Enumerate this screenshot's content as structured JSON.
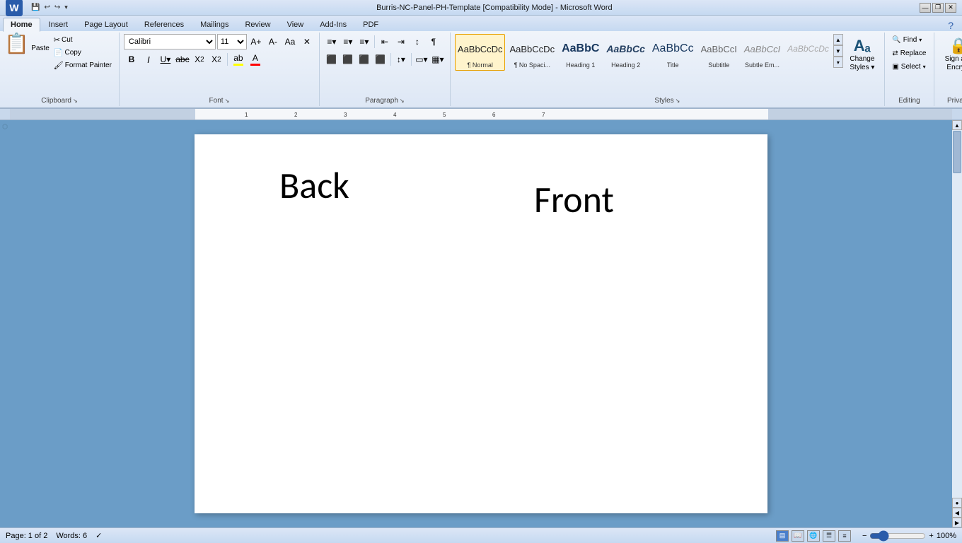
{
  "titlebar": {
    "title": "Burris-NC-Panel-PH-Template [Compatibility Mode] - Microsoft Word",
    "word_letter": "W",
    "quick_save": "💾",
    "quick_undo": "↩",
    "quick_redo": "↪",
    "min": "—",
    "restore": "❐",
    "close": "✕"
  },
  "tabs": [
    {
      "label": "Home",
      "active": true
    },
    {
      "label": "Insert",
      "active": false
    },
    {
      "label": "Page Layout",
      "active": false
    },
    {
      "label": "References",
      "active": false
    },
    {
      "label": "Mailings",
      "active": false
    },
    {
      "label": "Review",
      "active": false
    },
    {
      "label": "View",
      "active": false
    },
    {
      "label": "Add-Ins",
      "active": false
    },
    {
      "label": "PDF",
      "active": false
    }
  ],
  "clipboard": {
    "paste_label": "Paste",
    "cut_label": "Cut",
    "copy_label": "Copy",
    "format_painter_label": "Format Painter",
    "group_label": "Clipboard"
  },
  "font": {
    "name": "Calibri",
    "size": "11",
    "group_label": "Font",
    "bold": "B",
    "italic": "I",
    "underline": "U",
    "strikethrough": "abc",
    "subscript": "X₂",
    "superscript": "X²",
    "change_case": "Aa",
    "highlight": "A",
    "font_color": "A"
  },
  "paragraph": {
    "group_label": "Paragraph",
    "bullets": "≡",
    "numbering": "≡",
    "multilevel": "≡",
    "decrease_indent": "⇐",
    "increase_indent": "⇒",
    "sort": "↕",
    "show_marks": "¶",
    "align_left": "≡",
    "align_center": "≡",
    "align_right": "≡",
    "justify": "≡",
    "line_spacing": "≡",
    "shading": "▭",
    "border": "▭"
  },
  "styles": {
    "group_label": "Styles",
    "items": [
      {
        "label": "¶ Normal",
        "class": "normal-style",
        "active": true
      },
      {
        "label": "¶ No Spaci...",
        "class": "no-spacing-style",
        "active": false
      },
      {
        "label": "Heading 1",
        "class": "heading1-style",
        "active": false
      },
      {
        "label": "Heading 2",
        "class": "heading2-style",
        "active": false
      },
      {
        "label": "Title",
        "class": "title-style",
        "active": false
      },
      {
        "label": "Subtitle",
        "class": "subtitle-style",
        "active": false
      },
      {
        "label": "Subtle Em...",
        "class": "subtle-em-style",
        "active": false
      },
      {
        "label": "AaBbCcDc",
        "class": "subtle-em2-style",
        "active": false
      }
    ],
    "change_styles_label": "Change\nStyles",
    "expand_icon": "▼"
  },
  "editing": {
    "group_label": "Editing",
    "find_label": "Find",
    "replace_label": "Replace",
    "select_label": "Select"
  },
  "privacy": {
    "sign_encrypt_label": "Sign and\nEncrypt",
    "group_label": "Privacy"
  },
  "document": {
    "back_text": "Back",
    "front_text": "Front"
  },
  "statusbar": {
    "page_info": "Page: 1 of 2",
    "words_info": "Words: 6",
    "proofread_icon": "✓",
    "zoom_pct": "100%"
  },
  "ruler": {
    "marker_left": "◸",
    "marker_right": "▸"
  }
}
